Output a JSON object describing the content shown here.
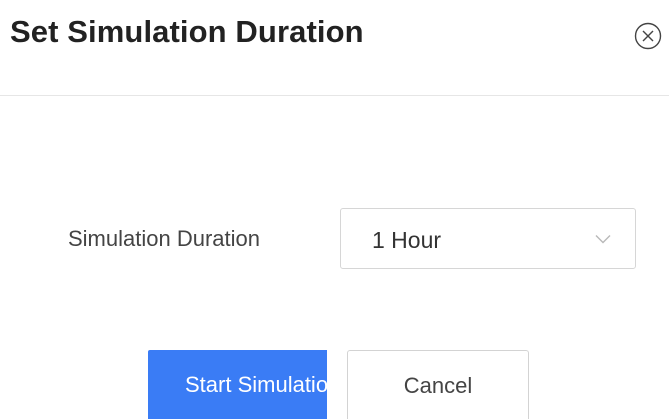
{
  "dialog": {
    "title": "Set Simulation Duration",
    "close_icon": "close-circle-icon"
  },
  "form": {
    "duration_label": "Simulation Duration",
    "duration_value": "1 Hour",
    "dropdown_icon": "chevron-down-icon"
  },
  "actions": {
    "start_label": "Start Simulation",
    "cancel_label": "Cancel"
  },
  "colors": {
    "primary": "#3a7cf5",
    "title_text": "#222222",
    "border": "#d6d6d6"
  }
}
